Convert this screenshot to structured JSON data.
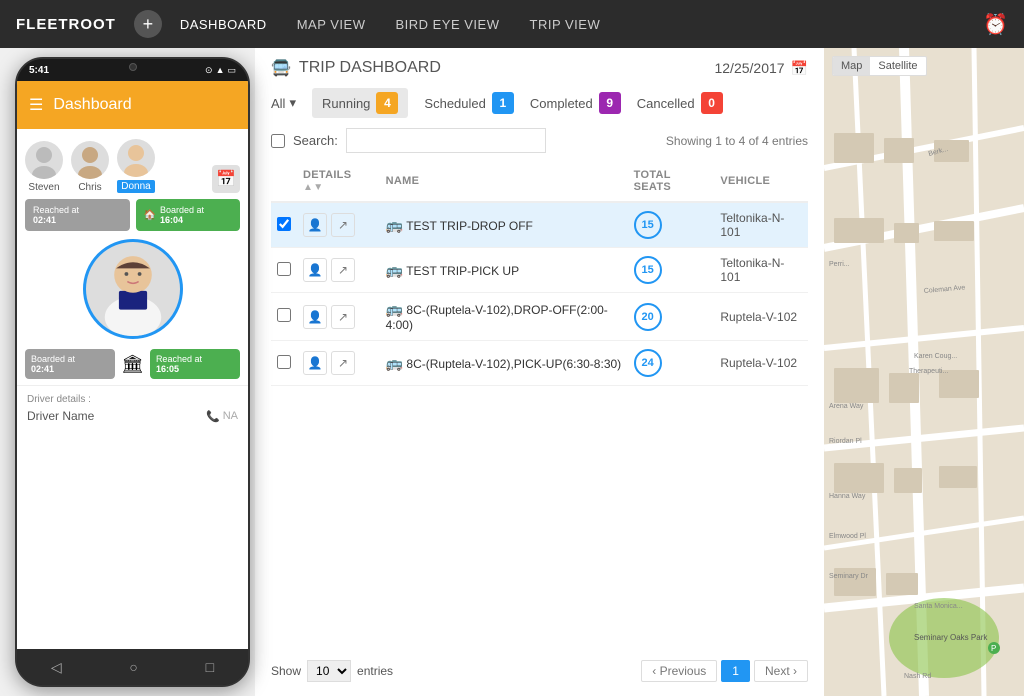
{
  "nav": {
    "brand": "FLEETROOT",
    "add_label": "+",
    "links": [
      "DASHBOARD",
      "MAP VIEW",
      "BIRD EYE VIEW",
      "TRIP VIEW"
    ],
    "active_link": "DASHBOARD"
  },
  "dashboard": {
    "title": "TRIP DASHBOARD",
    "date": "12/25/2017",
    "filter_all": "All",
    "filters": [
      {
        "label": "Running",
        "count": "4",
        "type": "running"
      },
      {
        "label": "Scheduled",
        "count": "1",
        "type": "scheduled"
      },
      {
        "label": "Completed",
        "count": "9",
        "type": "completed"
      },
      {
        "label": "Cancelled",
        "count": "0",
        "type": "cancelled"
      }
    ],
    "search_label": "Search:",
    "showing_text": "Showing 1 to 4 of 4 entries",
    "columns": [
      "",
      "DETAILS",
      "NAME",
      "TOTAL SEATS",
      "VEHICLE"
    ],
    "rows": [
      {
        "checked": true,
        "name": "TEST TRIP-DROP OFF",
        "seats": "15",
        "vehicle": "Teltonika-N-101"
      },
      {
        "checked": false,
        "name": "TEST TRIP-PICK UP",
        "seats": "15",
        "vehicle": "Teltonika-N-101"
      },
      {
        "checked": false,
        "name": "8C-(Ruptela-V-102),DROP-OFF(2:00-4:00)",
        "seats": "20",
        "vehicle": "Ruptela-V-102"
      },
      {
        "checked": false,
        "name": "8C-(Ruptela-V-102),PICK-UP(6:30-8:30)",
        "seats": "24",
        "vehicle": "Ruptela-V-102"
      }
    ],
    "show_label": "Show",
    "entries_label": "entries",
    "pagination": {
      "prev": "Previous",
      "next": "Next >",
      "current": "1"
    }
  },
  "phone": {
    "time": "5:41",
    "app_title": "Dashboard",
    "avatars": [
      {
        "name": "Steven",
        "selected": false
      },
      {
        "name": "Chris",
        "selected": false
      },
      {
        "name": "Donna",
        "selected": true
      }
    ],
    "boarded_label": "Boarded at",
    "boarded_time1": "02:41",
    "reached_label": "Reached at",
    "reached_time1": "02:41",
    "home_reached": "16:04",
    "boarded_time2": "02:41",
    "reached_time2": "16:05",
    "driver_details_label": "Driver details :",
    "driver_name": "Driver Name",
    "driver_phone_label": "NA"
  },
  "map": {
    "tab_map": "Map",
    "tab_satellite": "Satellite"
  }
}
